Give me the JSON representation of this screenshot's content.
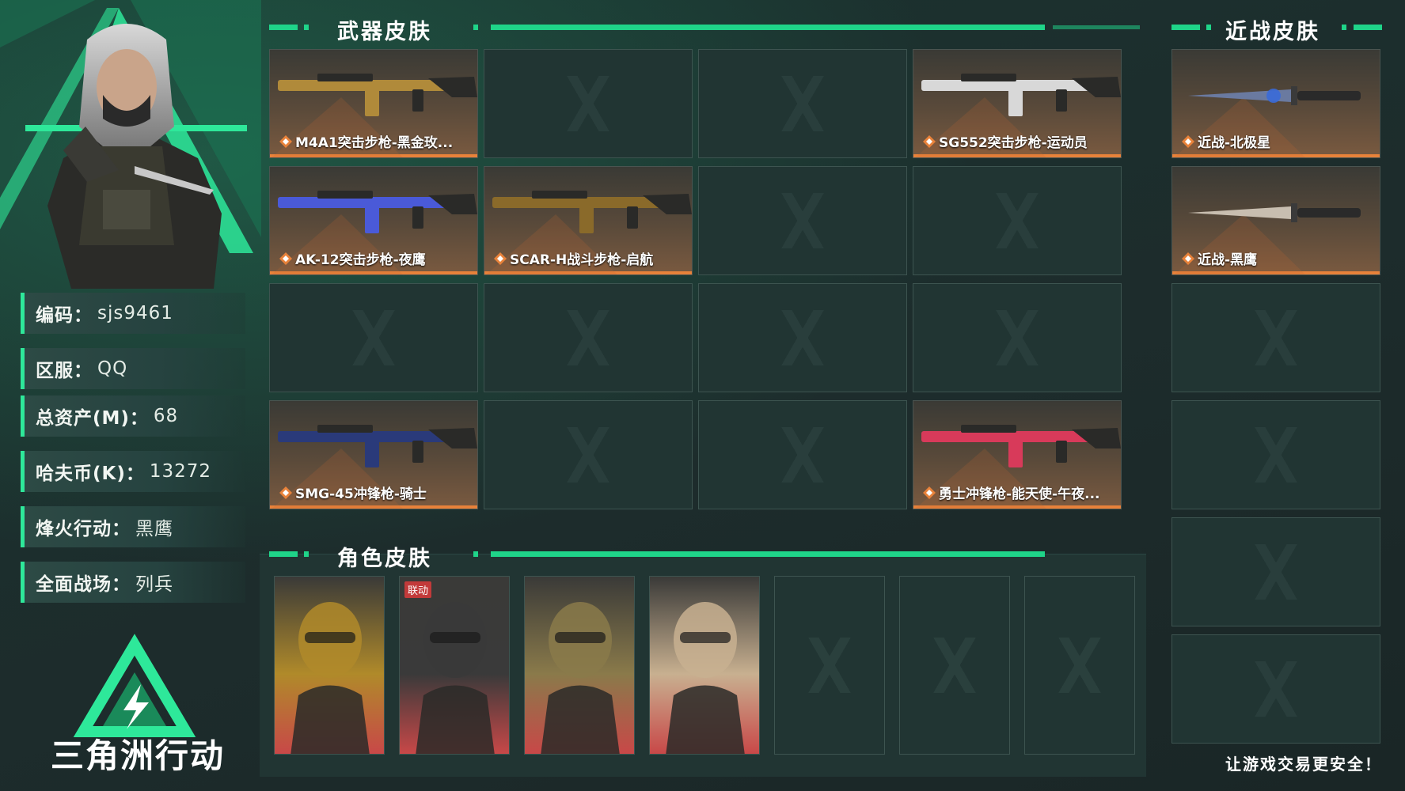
{
  "profile": {
    "fields": [
      {
        "key": "编码",
        "value": "sjs9461"
      },
      {
        "key": "区服",
        "value": "QQ"
      },
      {
        "key": "总资产(M)",
        "value": "68"
      },
      {
        "key": "哈夫币(K)",
        "value": "13272"
      },
      {
        "key": "烽火行动",
        "value": "黑鹰"
      },
      {
        "key": "全面战场",
        "value": "列兵"
      }
    ],
    "separator": "：",
    "logo_text": "三角洲行动"
  },
  "weapon_section": {
    "title": "武器皮肤",
    "slots": [
      {
        "label": "M4A1突击步枪-黑金玫...",
        "filled": true,
        "tint": "#b08a3a"
      },
      {
        "label": "",
        "filled": false
      },
      {
        "label": "",
        "filled": false
      },
      {
        "label": "SG552突击步枪-运动员",
        "filled": true,
        "tint": "#d8d8d8"
      },
      {
        "label": "AK-12突击步枪-夜鹰",
        "filled": true,
        "tint": "#4a5ad8"
      },
      {
        "label": "SCAR-H战斗步枪-启航",
        "filled": true,
        "tint": "#8a6a2a"
      },
      {
        "label": "",
        "filled": false
      },
      {
        "label": "",
        "filled": false
      },
      {
        "label": "",
        "filled": false
      },
      {
        "label": "",
        "filled": false
      },
      {
        "label": "",
        "filled": false
      },
      {
        "label": "",
        "filled": false
      },
      {
        "label": "SMG-45冲锋枪-骑士",
        "filled": true,
        "tint": "#2a3a7a"
      },
      {
        "label": "",
        "filled": false
      },
      {
        "label": "",
        "filled": false
      },
      {
        "label": "勇士冲锋枪-能天使-午夜...",
        "filled": true,
        "tint": "#d83a5a"
      }
    ]
  },
  "melee_section": {
    "title": "近战皮肤",
    "slots": [
      {
        "label": "近战-北极星",
        "filled": true
      },
      {
        "label": "近战-黑鹰",
        "filled": true
      },
      {
        "label": "",
        "filled": false
      },
      {
        "label": "",
        "filled": false
      },
      {
        "label": "",
        "filled": false
      },
      {
        "label": "",
        "filled": false
      }
    ]
  },
  "role_section": {
    "title": "角色皮肤",
    "cards": [
      {
        "filled": true,
        "badge": "",
        "tint": "#b08a2a"
      },
      {
        "filled": true,
        "badge": "联动",
        "tint": "#3a3a3a"
      },
      {
        "filled": true,
        "badge": "",
        "tint": "#8a7a4a"
      },
      {
        "filled": true,
        "badge": "",
        "tint": "#c8b090"
      },
      {
        "filled": false,
        "badge": ""
      },
      {
        "filled": false,
        "badge": ""
      },
      {
        "filled": false,
        "badge": ""
      }
    ]
  },
  "footer": {
    "slogan": "让游戏交易更安全！"
  },
  "colors": {
    "accent": "#1fd489",
    "label_bar": "#e8823a",
    "panel": "#213533"
  }
}
